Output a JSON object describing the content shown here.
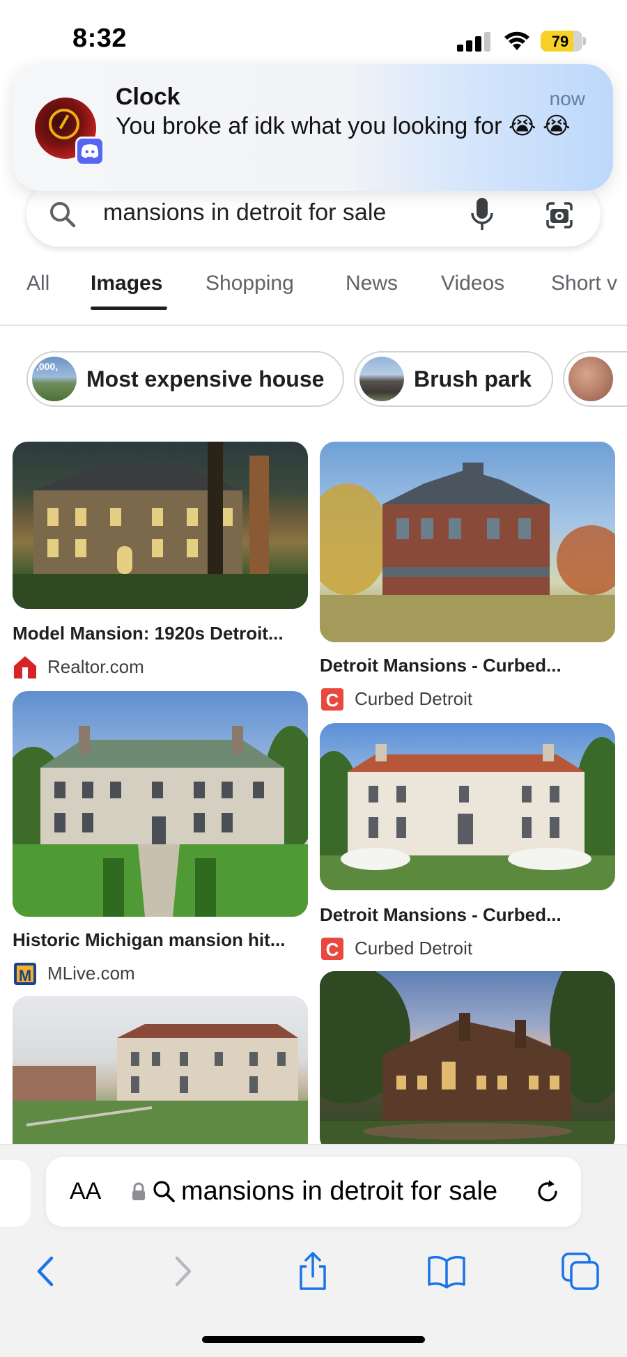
{
  "status_bar": {
    "time": "8:32",
    "battery_percent": "79",
    "battery_level": 0.79,
    "icons": [
      "signal-icon",
      "wifi-icon",
      "battery-charging-icon"
    ]
  },
  "notification": {
    "app_title": "Clock",
    "time": "now",
    "body": "You broke af idk what you looking for 😭 😭",
    "badge_icon": "discord-icon"
  },
  "search": {
    "query": "mansions in detroit for sale",
    "icons": [
      "search-icon",
      "mic-icon",
      "lens-icon"
    ]
  },
  "tabs": [
    {
      "label": "All",
      "active": false
    },
    {
      "label": "Images",
      "active": true
    },
    {
      "label": "Shopping",
      "active": false
    },
    {
      "label": "News",
      "active": false
    },
    {
      "label": "Videos",
      "active": false
    },
    {
      "label": "Short v",
      "active": false
    }
  ],
  "chips": [
    {
      "label": "Most expensive house",
      "thumb_text": ",000,"
    },
    {
      "label": "Brush park"
    },
    {
      "label": ""
    }
  ],
  "results": [
    {
      "title": "Model Mansion: 1920s Detroit...",
      "source": "Realtor.com",
      "favicon": "realtor-icon"
    },
    {
      "title": "Detroit Mansions - Curbed...",
      "source": "Curbed Detroit",
      "favicon": "curbed-icon"
    },
    {
      "title": "Historic Michigan mansion hit...",
      "source": "MLive.com",
      "favicon": "mlive-icon"
    },
    {
      "title": "Detroit Mansions - Curbed...",
      "source": "Curbed Detroit",
      "favicon": "curbed-icon"
    },
    {
      "title": "",
      "source": ""
    },
    {
      "title": "",
      "source": ""
    }
  ],
  "favicon_letters": {
    "curbed": "C",
    "mlive": "M"
  },
  "address_bar": {
    "text_size_label": "AA",
    "url": "mansions in detroit for sale"
  },
  "toolbar": {
    "icons": [
      "back-icon",
      "forward-icon",
      "share-icon",
      "bookmarks-icon",
      "tabs-icon"
    ]
  },
  "colors": {
    "safari_blue": "#1a73e8",
    "discord": "#5865f2",
    "realtor_red": "#d92228",
    "curbed_red": "#e8483d",
    "mlive_blue": "#1c3f94",
    "battery_yellow": "#f7d126"
  }
}
